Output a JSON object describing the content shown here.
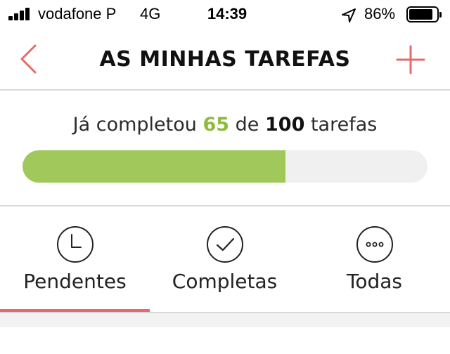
{
  "status_bar": {
    "carrier": "vodafone P",
    "network": "4G",
    "time": "14:39",
    "battery_percent": "86%",
    "battery_level": 0.86
  },
  "nav": {
    "title": "AS MINHAS TAREFAS",
    "accent_color": "#e66a6a"
  },
  "progress": {
    "prefix": "Já completou",
    "completed": "65",
    "middle": "de",
    "total": "100",
    "suffix": "tarefas",
    "fraction": 0.65,
    "fill_color": "#a0c85b"
  },
  "tabs": [
    {
      "label": "Pendentes",
      "icon": "clock-icon",
      "active": true
    },
    {
      "label": "Completas",
      "icon": "checkmark-icon",
      "active": false
    },
    {
      "label": "Todas",
      "icon": "more-dots-icon",
      "active": false
    }
  ]
}
